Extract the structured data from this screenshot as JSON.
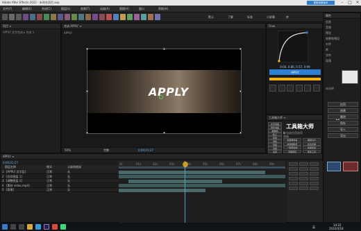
{
  "app": {
    "title": "Adobe After Effects 2022 - 未命名项目.aep",
    "upgrade_label": "更新到新版本"
  },
  "menu": [
    "文件(F)",
    "编辑(E)",
    "合成(C)",
    "图层(L)",
    "效果(T)",
    "动画(A)",
    "视图(V)",
    "窗口",
    "帮助(H)"
  ],
  "workspace_tabs": [
    "默认",
    "了解",
    "标准",
    "小屏幕",
    "库"
  ],
  "project_panel": {
    "tab": "项目 ≡",
    "comp_name": "APPLY 文字合成 ▸ 合成 1"
  },
  "composition": {
    "tab": "合成 APPLY ≡",
    "breadcrumb": "APPLY",
    "title_text": "APPLY",
    "zoom": "50%",
    "resolution": "完整",
    "timecode": "0;00;01;27"
  },
  "graph_panel": {
    "tab": "Flow",
    "readout": "0.00, 0.80, 0.57, 0.99",
    "apply_label": "APPLY",
    "preset_count": 6
  },
  "plugin_panel": {
    "tab": "工具箱大师 ≡",
    "heading": "工具箱大师",
    "items": [
      "文字动画",
      "形状动画",
      "摄像机",
      "粒子",
      "转场",
      "调色",
      "音频",
      "渲染",
      "设置"
    ],
    "checkbox_label": "勾选应用选项",
    "section_label": "高级",
    "buttons": [
      "批量重命名",
      "图层对齐",
      "关键帧助手",
      "表达式库",
      "一键预合成",
      "快速导出",
      "清理项目",
      "更多工具"
    ]
  },
  "right_panel": {
    "tab": "属性",
    "search_placeholder": "搜索",
    "labels": [
      "信息",
      "音频",
      "预览",
      "效果和预设",
      "对齐",
      "库",
      "字符",
      "段落"
    ],
    "list_title": "未选择",
    "buttons": [
      "应用",
      "创建",
      "删除",
      "保存",
      "导入",
      "导出"
    ]
  },
  "timeline": {
    "tab": "APPLY ≡",
    "timecode": "0;00;01;27",
    "columns": [
      "图层名称",
      "模式",
      "父级和链接"
    ],
    "layers": [
      {
        "num": "1",
        "name": "[APPLY 文字层]",
        "mode": "正常",
        "parent": "无"
      },
      {
        "num": "2",
        "name": "[形状图层 1]",
        "mode": "正常",
        "parent": "无"
      },
      {
        "num": "3",
        "name": "[调整图层 2]",
        "mode": "正常",
        "parent": "无"
      },
      {
        "num": "4",
        "name": "[素材 video.mp4]",
        "mode": "正常",
        "parent": "无"
      },
      {
        "num": "5",
        "name": "[背景]",
        "mode": "正常",
        "parent": "无"
      }
    ],
    "ruler": [
      "0s",
      "01s",
      "02s",
      "03s",
      "04s",
      "05s",
      "06s",
      "07s",
      "08s",
      "09s"
    ]
  },
  "taskbar": {
    "time": "14:22",
    "date": "2022/4/18",
    "lang": "英"
  },
  "colors": {
    "accent": "#2d7fd3",
    "yellow": "#f2b21a",
    "playhead": "#4fa3c7",
    "track": "#4a6a6a"
  }
}
